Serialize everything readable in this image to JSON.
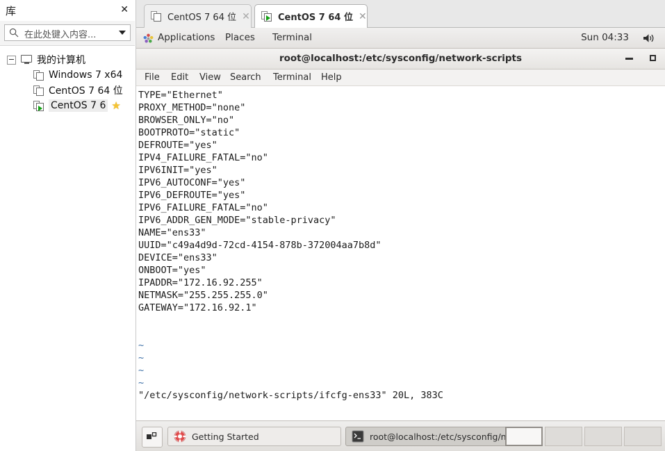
{
  "library": {
    "title": "库",
    "close_label": "✕",
    "search": {
      "placeholder": "在此处键入内容...",
      "value": "",
      "icon": "search-icon",
      "dropdown_icon": "chevron-down-icon"
    },
    "tree": {
      "root": {
        "label": "我的计算机",
        "icon": "computer-icon",
        "expander": "collapse-minus-icon"
      },
      "items": [
        {
          "label": "Windows 7 x64",
          "icon": "vm-icon",
          "running": false,
          "starred": false,
          "selected": false
        },
        {
          "label": "CentOS 7 64 位",
          "icon": "vm-icon",
          "running": false,
          "starred": false,
          "selected": false
        },
        {
          "label": "CentOS 7 6",
          "icon": "vm-icon-running",
          "running": true,
          "starred": true,
          "selected": true,
          "star": "★"
        }
      ]
    }
  },
  "vmware_tabs": [
    {
      "label": "CentOS 7 64 位",
      "active": false,
      "running": false,
      "close": "✕"
    },
    {
      "label": "CentOS 7 64 位",
      "active": true,
      "running": true,
      "close": "✕"
    }
  ],
  "gnome_topbar": {
    "apps_icon": "applications-icon",
    "menus": [
      "Applications",
      "Places",
      "Terminal"
    ],
    "clock": "Sun 04:33",
    "volume_icon": "volume-icon"
  },
  "terminal": {
    "title": "root@localhost:/etc/sysconfig/network-scripts",
    "minimize_label": "—",
    "maximize_label": "□",
    "menus": [
      "File",
      "Edit",
      "View",
      "Search",
      "Terminal",
      "Help"
    ],
    "content_lines": [
      "TYPE=\"Ethernet\"",
      "PROXY_METHOD=\"none\"",
      "BROWSER_ONLY=\"no\"",
      "BOOTPROTO=\"static\"",
      "DEFROUTE=\"yes\"",
      "IPV4_FAILURE_FATAL=\"no\"",
      "IPV6INIT=\"yes\"",
      "IPV6_AUTOCONF=\"yes\"",
      "IPV6_DEFROUTE=\"yes\"",
      "IPV6_FAILURE_FATAL=\"no\"",
      "IPV6_ADDR_GEN_MODE=\"stable-privacy\"",
      "NAME=\"ens33\"",
      "UUID=\"c49a4d9d-72cd-4154-878b-372004aa7b8d\"",
      "DEVICE=\"ens33\"",
      "ONBOOT=\"yes\"",
      "IPADDR=\"172.16.92.255\"",
      "NETMASK=\"255.255.255.0\"",
      "GATEWAY=\"172.16.92.1\""
    ],
    "empty_markers": [
      "~",
      "~",
      "~",
      "~"
    ],
    "status_line": "\"/etc/sysconfig/network-scripts/ifcfg-ens33\" 20L, 383C"
  },
  "taskbar": {
    "show_desktop_icon": "show-desktop-icon",
    "buttons": [
      {
        "label": "Getting Started",
        "icon": "help-icon",
        "active": false
      },
      {
        "label": "root@localhost:/etc/sysconfig/net...",
        "icon": "terminal-icon",
        "active": true
      }
    ],
    "workspaces": [
      {
        "active": true
      },
      {
        "active": false
      },
      {
        "active": false
      },
      {
        "active": false
      }
    ]
  },
  "colors": {
    "tilde_blue": "#3b6ea5",
    "vm_running_green": "#13a013",
    "star_gold": "#f5c331",
    "terminal_text": "#1a1a1a"
  }
}
